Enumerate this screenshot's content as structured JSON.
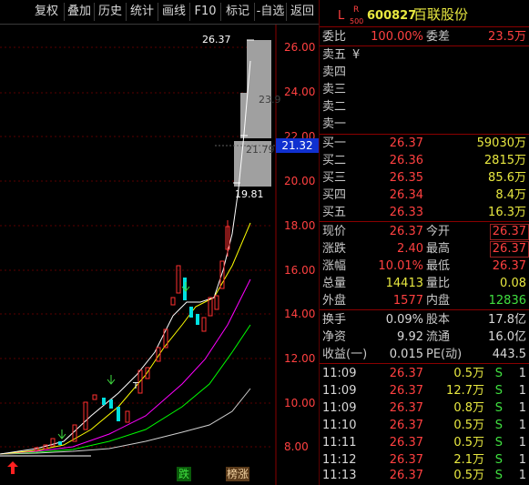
{
  "toolbar": {
    "buttons": [
      "复权",
      "叠加",
      "历史",
      "统计",
      "画线",
      "F10",
      "标记",
      "-自选",
      "返回"
    ]
  },
  "stock": {
    "flag": "L",
    "badge_top": "R",
    "badge_bottom": "500",
    "code": "600827",
    "name": "百联股份"
  },
  "weibi": {
    "label1": "委比",
    "value1": "100.00%",
    "label2": "委差",
    "value2": "23.5万"
  },
  "sell": [
    {
      "label": "卖五",
      "extra": "¥"
    },
    {
      "label": "卖四",
      "extra": ""
    },
    {
      "label": "卖三",
      "extra": ""
    },
    {
      "label": "卖二",
      "extra": ""
    },
    {
      "label": "卖一",
      "extra": ""
    }
  ],
  "buy": [
    {
      "label": "买一",
      "price": "26.37",
      "volume": "59030万"
    },
    {
      "label": "买二",
      "price": "26.36",
      "volume": "2815万"
    },
    {
      "label": "买三",
      "price": "26.35",
      "volume": "85.6万"
    },
    {
      "label": "买四",
      "price": "26.34",
      "volume": "8.4万"
    },
    {
      "label": "买五",
      "price": "26.33",
      "volume": "16.3万"
    }
  ],
  "quote": [
    {
      "l1": "现价",
      "v1": "26.37",
      "l2": "今开",
      "v2": "26.37",
      "boxed": true
    },
    {
      "l1": "涨跌",
      "v1": "2.40",
      "l2": "最高",
      "v2": "26.37",
      "boxed": true
    },
    {
      "l1": "涨幅",
      "v1": "10.01%",
      "l2": "最低",
      "v2": "26.37",
      "boxed": false
    },
    {
      "l1": "总量",
      "v1": "14413",
      "l2": "量比",
      "v2": "0.08",
      "boxed": false
    },
    {
      "l1": "外盘",
      "v1": "1577",
      "l2": "内盘",
      "v2": "12836",
      "boxed": false
    }
  ],
  "fund": [
    {
      "l1": "换手",
      "v1": "0.09%",
      "l2": "股本",
      "v2": "17.8亿"
    },
    {
      "l1": "净资",
      "v1": "9.92",
      "l2": "流通",
      "v2": "16.0亿"
    },
    {
      "l1": "收益(一)",
      "v1": "0.015",
      "l2": "PE(动)",
      "v2": "443.5"
    }
  ],
  "ticks": [
    {
      "time": "11:09",
      "price": "26.37",
      "vol": "0.5万",
      "side": "S",
      "n": "1"
    },
    {
      "time": "11:09",
      "price": "26.37",
      "vol": "12.7万",
      "side": "S",
      "n": "1"
    },
    {
      "time": "11:09",
      "price": "26.37",
      "vol": "0.8万",
      "side": "S",
      "n": "1"
    },
    {
      "time": "11:10",
      "price": "26.37",
      "vol": "0.5万",
      "side": "S",
      "n": "1"
    },
    {
      "time": "11:11",
      "price": "26.37",
      "vol": "0.5万",
      "side": "S",
      "n": "1"
    },
    {
      "time": "11:12",
      "price": "26.37",
      "vol": "2.1万",
      "side": "S",
      "n": "1"
    },
    {
      "time": "11:13",
      "price": "26.37",
      "vol": "0.5万",
      "side": "S",
      "n": "1"
    }
  ],
  "chart": {
    "axis_labels": [
      "26.00",
      "24.00",
      "22.00",
      "20.00",
      "18.00",
      "16.00",
      "14.00",
      "12.00",
      "10.00",
      "8.00"
    ],
    "current_price_label": "21.32",
    "annotations": {
      "high": "26.37",
      "mid": "23.9",
      "mid2": "21.79",
      "low": "19.81",
      "t_marker": "T"
    },
    "bottom_badges": {
      "die": "跌",
      "bangzhang": "榜涨"
    },
    "colors": {
      "up": "#ff3030",
      "down": "#00e0e0",
      "ma5": "#ffffff",
      "ma10": "#ffff00",
      "ma20": "#ff00ff",
      "ma30": "#00ff00",
      "ma60": "#d0d0d0",
      "cursor": "#2040ff"
    }
  }
}
